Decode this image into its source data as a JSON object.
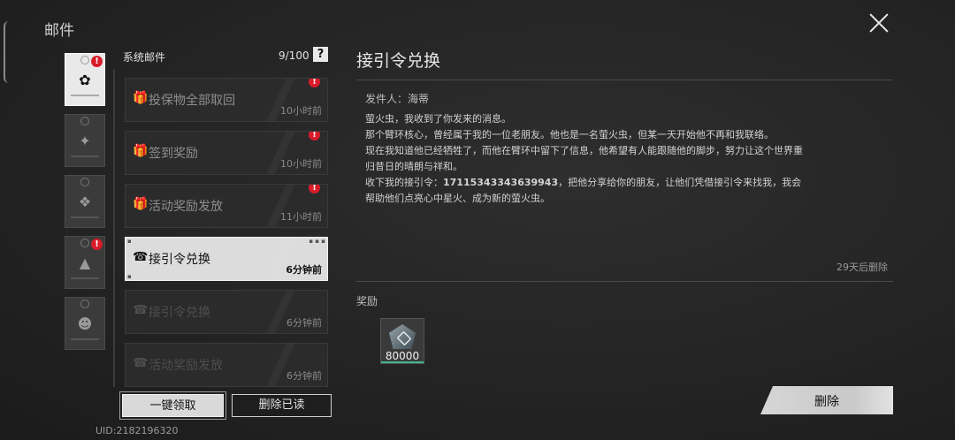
{
  "page": {
    "title": "邮件"
  },
  "categories": [
    {
      "glyph": "✿",
      "badge": "!",
      "active": true
    },
    {
      "glyph": "✦"
    },
    {
      "glyph": "❖"
    },
    {
      "glyph": "▲",
      "badge": "!"
    },
    {
      "glyph": "☻"
    }
  ],
  "list": {
    "header": "系统邮件",
    "count": "9/100",
    "help": "?",
    "mails": [
      {
        "icon": "gift-icon",
        "glyph": "🎁",
        "title": "投保物全部取回",
        "time": "10小时前",
        "badge": "!"
      },
      {
        "icon": "gift-icon",
        "glyph": "🎁",
        "title": "签到奖励",
        "time": "10小时前",
        "badge": "!"
      },
      {
        "icon": "gift-icon",
        "glyph": "🎁",
        "title": "活动奖励发放",
        "time": "11小时前",
        "badge": "!"
      },
      {
        "icon": "phone-icon",
        "glyph": "☎",
        "title": "接引令兑换",
        "time": "6分钟前",
        "selected": true
      },
      {
        "icon": "phone-icon",
        "glyph": "☎",
        "title": "接引令兑换",
        "time": "6分钟前"
      },
      {
        "icon": "phone-icon",
        "glyph": "☎",
        "title": "活动奖励发放",
        "time": "6分钟前"
      }
    ],
    "claim_all": "一键领取",
    "delete_read": "删除已读"
  },
  "uid": "UID:2182196320",
  "detail": {
    "title": "接引令兑换",
    "sender": "发件人：海蒂",
    "lines": [
      "萤火虫，我收到了你发来的消息。",
      "那个臂环核心，曾经属于我的一位老朋友。他也是一名萤火虫，但某一天开始他不再和我联络。",
      "现在我知道他已经牺牲了，而他在臂环中留下了信息，他希望有人能跟随他的脚步，努力让这个世界重归昔日的晴朗与祥和。"
    ],
    "last_line_prefix": "收下我的接引令：",
    "code": "17115343343639943",
    "last_line_suffix": "，把他分享给你的朋友，让他们凭借接引令来找我，我会帮助他们点亮心中星火、成为新的萤火虫。",
    "expire": "29天后删除",
    "reward_label": "奖励",
    "reward_qty": "80000",
    "delete": "删除"
  }
}
